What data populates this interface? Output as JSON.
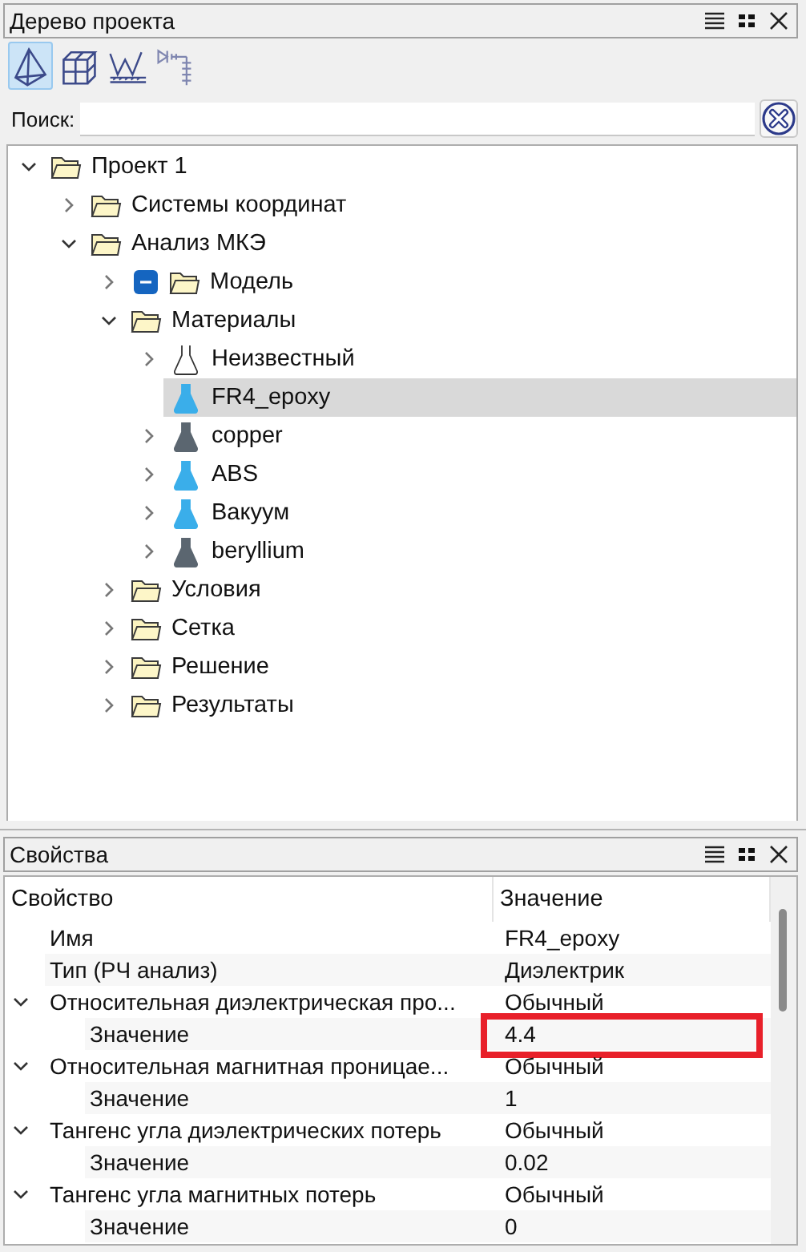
{
  "project_panel": {
    "title": "Дерево проекта",
    "toolbar": [
      {
        "selected": true
      },
      {
        "selected": false
      },
      {
        "selected": false
      },
      {
        "selected": false
      }
    ],
    "search": {
      "label": "Поиск:"
    },
    "tree": [
      {
        "label": "Проект 1",
        "kind": "folder",
        "expanded": true,
        "selected": false,
        "children": [
          {
            "label": "Системы координат",
            "kind": "folder",
            "expanded": false,
            "selected": false
          },
          {
            "label": "Анализ МКЭ",
            "kind": "folder",
            "expanded": true,
            "selected": false,
            "children": [
              {
                "label": "Модель",
                "kind": "folder",
                "expanded": false,
                "selected": false,
                "mixed": true
              },
              {
                "label": "Материалы",
                "kind": "folder",
                "expanded": true,
                "selected": false,
                "children": [
                  {
                    "label": "Неизвестный",
                    "kind": "material",
                    "color": "#ffffff",
                    "expanded": false,
                    "selected": false
                  },
                  {
                    "label": "FR4_epoxy",
                    "kind": "material",
                    "color": "#3aaeea",
                    "selected": true
                  },
                  {
                    "label": "copper",
                    "kind": "material",
                    "color": "#5b6670",
                    "expanded": false,
                    "selected": false
                  },
                  {
                    "label": "ABS",
                    "kind": "material",
                    "color": "#3aaeea",
                    "expanded": false,
                    "selected": false
                  },
                  {
                    "label": "Вакуум",
                    "kind": "material",
                    "color": "#3aaeea",
                    "expanded": false,
                    "selected": false
                  },
                  {
                    "label": "beryllium",
                    "kind": "material",
                    "color": "#5b6670",
                    "expanded": false,
                    "selected": false
                  }
                ]
              },
              {
                "label": "Условия",
                "kind": "folder",
                "expanded": false,
                "selected": false
              },
              {
                "label": "Сетка",
                "kind": "folder",
                "expanded": false,
                "selected": false
              },
              {
                "label": "Решение",
                "kind": "folder",
                "expanded": false,
                "selected": false
              },
              {
                "label": "Результаты",
                "kind": "folder",
                "expanded": false,
                "selected": false
              }
            ]
          }
        ]
      }
    ]
  },
  "properties_panel": {
    "title": "Свойства",
    "columns": [
      "Свойство",
      "Значение"
    ],
    "rows": [
      {
        "name": "Имя",
        "value": "FR4_epoxy"
      },
      {
        "name": "Тип (РЧ анализ)",
        "value": "Диэлектрик"
      },
      {
        "name": "Относительная диэлектрическая про...",
        "value": "Обычный",
        "expanded": true,
        "children": [
          {
            "name": "Значение",
            "value": "4.4",
            "highlighted": true
          }
        ]
      },
      {
        "name": "Относительная магнитная проницае...",
        "value": "Обычный",
        "expanded": true,
        "children": [
          {
            "name": "Значение",
            "value": "1"
          }
        ]
      },
      {
        "name": "Тангенс угла диэлектрических потерь",
        "value": "Обычный",
        "expanded": true,
        "children": [
          {
            "name": "Значение",
            "value": "0.02"
          }
        ]
      },
      {
        "name": "Тангенс угла магнитных потерь",
        "value": "Обычный",
        "expanded": true,
        "children": [
          {
            "name": "Значение",
            "value": "0"
          }
        ]
      }
    ]
  }
}
